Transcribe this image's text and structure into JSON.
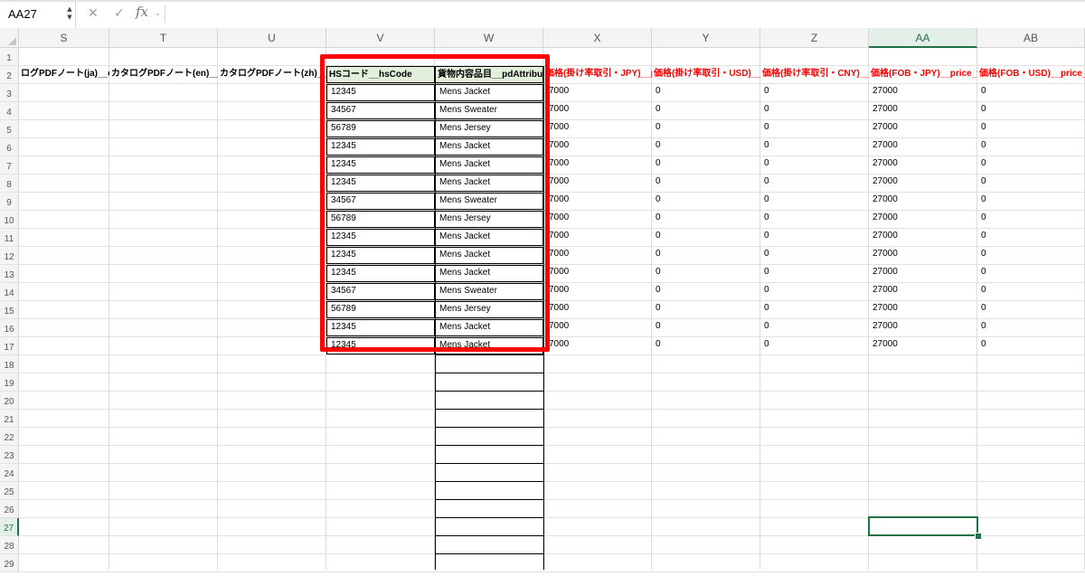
{
  "formula_bar": {
    "name_box": "AA27",
    "name_box_arrows_icon": "stepper-arrows-icon",
    "cancel_glyph": "✕",
    "enter_glyph": "✓",
    "fx_label": "fx",
    "fx_chevron": "⌄",
    "formula_value": ""
  },
  "columns": [
    "S",
    "T",
    "U",
    "V",
    "W",
    "X",
    "Y",
    "Z",
    "AA",
    "AB"
  ],
  "selected_column": "AA",
  "rows": [
    1,
    2,
    3,
    4,
    5,
    6,
    7,
    8,
    9,
    10,
    11,
    12,
    13,
    14,
    15,
    16,
    17,
    18,
    19,
    20,
    21,
    22,
    23,
    24,
    25,
    26,
    27,
    28,
    29
  ],
  "selected_row": 27,
  "header_row": {
    "S": "ログPDFノート(ja)__catalogPdfNoteJa",
    "T": "カタログPDFノート(en)__catalogPdfNoteEn",
    "U": "カタログPDFノート(zh)__catalogPdfNoteZh",
    "V": "HSコード__hsCode",
    "W": "貨物内容品目__pdAttribute",
    "X": "価格(掛け率取引・JPY)__price",
    "Y": "価格(掛け率取引・USD)__price",
    "Z": "価格(掛け率取引・CNY)__price",
    "AA": "価格(FOB・JPY)__price_fob",
    "AB": "価格(FOB・USD)__price_fob"
  },
  "data_rows": [
    {
      "V": "12345",
      "W": "Mens Jacket",
      "X": "7000",
      "Y": "0",
      "Z": "0",
      "AA": "27000",
      "AB": "0"
    },
    {
      "V": "34567",
      "W": "Mens Sweater",
      "X": "7000",
      "Y": "0",
      "Z": "0",
      "AA": "27000",
      "AB": "0"
    },
    {
      "V": "56789",
      "W": "Mens Jersey",
      "X": "7000",
      "Y": "0",
      "Z": "0",
      "AA": "27000",
      "AB": "0"
    },
    {
      "V": "12345",
      "W": "Mens Jacket",
      "X": "7000",
      "Y": "0",
      "Z": "0",
      "AA": "27000",
      "AB": "0"
    },
    {
      "V": "12345",
      "W": "Mens Jacket",
      "X": "7000",
      "Y": "0",
      "Z": "0",
      "AA": "27000",
      "AB": "0"
    },
    {
      "V": "12345",
      "W": "Mens Jacket",
      "X": "7000",
      "Y": "0",
      "Z": "0",
      "AA": "27000",
      "AB": "0"
    },
    {
      "V": "34567",
      "W": "Mens Sweater",
      "X": "7000",
      "Y": "0",
      "Z": "0",
      "AA": "27000",
      "AB": "0"
    },
    {
      "V": "56789",
      "W": "Mens Jersey",
      "X": "7000",
      "Y": "0",
      "Z": "0",
      "AA": "27000",
      "AB": "0"
    },
    {
      "V": "12345",
      "W": "Mens Jacket",
      "X": "7000",
      "Y": "0",
      "Z": "0",
      "AA": "27000",
      "AB": "0"
    },
    {
      "V": "12345",
      "W": "Mens Jacket",
      "X": "7000",
      "Y": "0",
      "Z": "0",
      "AA": "27000",
      "AB": "0"
    },
    {
      "V": "12345",
      "W": "Mens Jacket",
      "X": "7000",
      "Y": "0",
      "Z": "0",
      "AA": "27000",
      "AB": "0"
    },
    {
      "V": "34567",
      "W": "Mens Sweater",
      "X": "7000",
      "Y": "0",
      "Z": "0",
      "AA": "27000",
      "AB": "0"
    },
    {
      "V": "56789",
      "W": "Mens Jersey",
      "X": "7000",
      "Y": "0",
      "Z": "0",
      "AA": "27000",
      "AB": "0"
    },
    {
      "V": "12345",
      "W": "Mens Jacket",
      "X": "7000",
      "Y": "0",
      "Z": "0",
      "AA": "27000",
      "AB": "0"
    },
    {
      "V": "12345",
      "W": "Mens Jacket",
      "X": "7000",
      "Y": "0",
      "Z": "0",
      "AA": "27000",
      "AB": "0"
    }
  ],
  "colors": {
    "header_green_fill": "#e2efda",
    "price_header_text": "#ff0000",
    "highlight_box": "#ff0000",
    "selection": "#217346"
  }
}
